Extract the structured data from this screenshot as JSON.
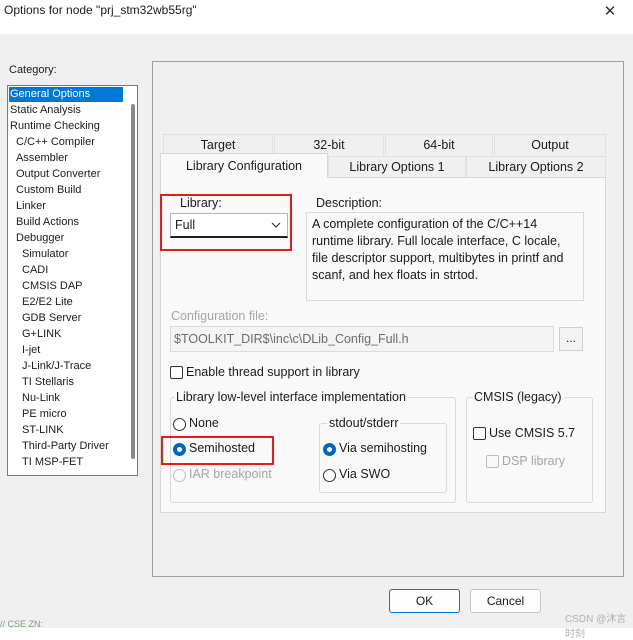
{
  "window": {
    "title": "Options for node \"prj_stm32wb55rg\"",
    "close_glyph": "✕"
  },
  "category": {
    "label": "Category:",
    "items": [
      "General Options",
      "Static Analysis",
      "Runtime Checking",
      "C/C++ Compiler",
      "Assembler",
      "Output Converter",
      "Custom Build",
      "Linker",
      "Build Actions",
      "Debugger",
      "Simulator",
      "CADI",
      "CMSIS DAP",
      "E2/E2 Lite",
      "GDB Server",
      "G+LINK",
      "I-jet",
      "J-Link/J-Trace",
      "TI Stellaris",
      "Nu-Link",
      "PE micro",
      "ST-LINK",
      "Third-Party Driver",
      "TI MSP-FET"
    ],
    "selected": "General Options"
  },
  "tabs": {
    "row1": [
      "Target",
      "32-bit",
      "64-bit",
      "Output"
    ],
    "row2": [
      "Library Configuration",
      "Library Options 1",
      "Library Options 2"
    ],
    "active": "Library Configuration"
  },
  "library": {
    "label": "Library:",
    "value": "Full",
    "description_label": "Description:",
    "description": "A complete configuration of the C/C++14 runtime library. Full locale interface, C locale, file descriptor support, multibytes in printf and scanf, and hex floats in strtod."
  },
  "config_file": {
    "label": "Configuration file:",
    "value": "$TOOLKIT_DIR$\\inc\\c\\DLib_Config_Full.h",
    "browse_label": "..."
  },
  "thread_support": {
    "label": "Enable thread support in library",
    "checked": false
  },
  "low_level": {
    "title": "Library low-level interface implementation",
    "options": [
      "None",
      "Semihosted",
      "IAR breakpoint"
    ],
    "selected": "Semihosted",
    "stdout": {
      "title": "stdout/stderr",
      "options": [
        "Via semihosting",
        "Via SWO"
      ],
      "selected": "Via semihosting"
    }
  },
  "cmsis": {
    "title": "CMSIS (legacy)",
    "use_label": "Use CMSIS 5.7",
    "dsp_label": "DSP library"
  },
  "buttons": {
    "ok": "OK",
    "cancel": "Cancel"
  },
  "watermark": "CSDN @沐言时刻",
  "bottom_fragment": "// CSE ZN:",
  "colors": {
    "accent": "#0078d7",
    "highlight_red": "#e21b1b"
  }
}
